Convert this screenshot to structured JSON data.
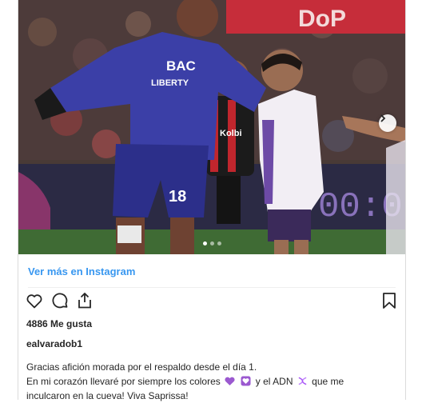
{
  "post": {
    "view_more_label": "Ver más en Instagram",
    "likes_text": "4886 Me gusta",
    "username": "ealvaradob1",
    "caption_line1": "Gracias afición morada por el respaldo desde el día 1.",
    "caption_line2_a": "En mi corazón llevaré por siempre los colores",
    "caption_line2_b": "y el ADN",
    "caption_line2_c": "que me",
    "caption_line3": "inculcaron en la cueva! Viva Saprissa!"
  },
  "photo": {
    "jersey_sponsor_1": "BAC",
    "jersey_sponsor_2": "LIBERTY",
    "jersey_number": "18",
    "player2_sponsor": "Kolbi",
    "banner_text": "DoP",
    "board_text": "00:0",
    "carousel_total": 3,
    "carousel_active": 1
  },
  "icons": {
    "like": "heart-icon",
    "comment": "comment-icon",
    "share": "share-icon",
    "save": "bookmark-icon",
    "next": "chevron-right-icon"
  },
  "colors": {
    "link": "#3897f0",
    "emoji_purple": "#9b59d0",
    "emoji_dna": "#c084fc"
  }
}
